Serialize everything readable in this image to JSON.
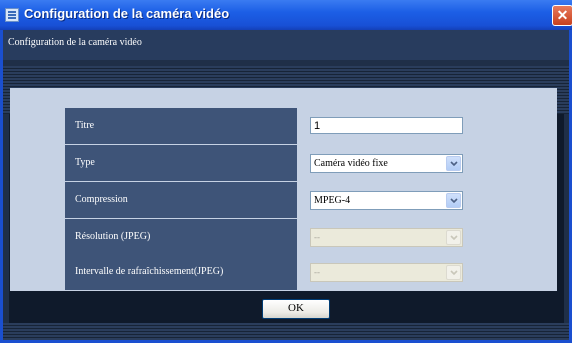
{
  "window": {
    "title": "Configuration de la caméra vidéo",
    "close_glyph": "✕"
  },
  "header": {
    "text": "Configuration de la caméra vidéo"
  },
  "form": {
    "title_label": "Titre",
    "title_value": "1",
    "type_label": "Type",
    "type_value": "Caméra vidéo fixe",
    "compression_label": "Compression",
    "compression_value": "MPEG-4",
    "resolution_label": "Résolution (JPEG)",
    "resolution_value": "--",
    "refresh_label": "Intervalle de rafraîchissement(JPEG)",
    "refresh_value": "--"
  },
  "buttons": {
    "ok_label": "OK"
  },
  "colors": {
    "titlebar": "#1c5fe6",
    "label_cell": "#3e5478",
    "panel": "#c6d2e4",
    "background": "#1f2f48"
  },
  "icons": {
    "window": "window-icon",
    "close": "close-icon",
    "dropdown": "chevron-down-icon"
  }
}
